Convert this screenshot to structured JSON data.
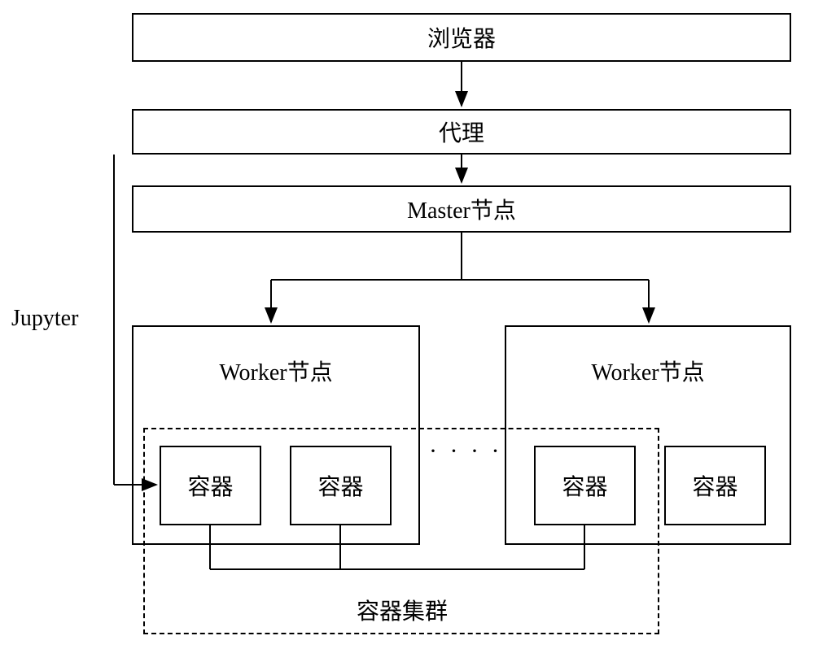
{
  "boxes": {
    "browser": "浏览器",
    "proxy": "代理",
    "master": "Master节点",
    "worker1": "Worker节点",
    "worker2": "Worker节点",
    "container1a": "容器",
    "container1b": "容器",
    "container2a": "容器",
    "container2b": "容器"
  },
  "labels": {
    "jupyter": "Jupyter",
    "ellipsis": "· · · ·",
    "cluster": "容器集群"
  }
}
